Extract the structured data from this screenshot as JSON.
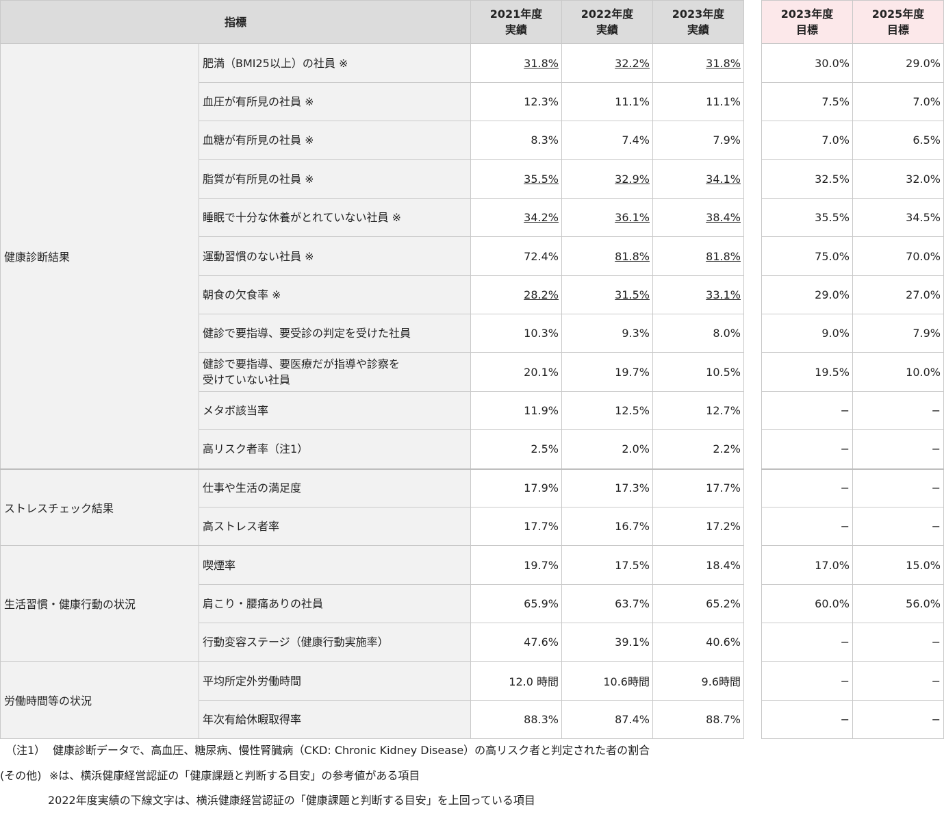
{
  "header": {
    "indicator": "指標",
    "cols": [
      {
        "l1": "2021年度",
        "l2": "実績"
      },
      {
        "l1": "2022年度",
        "l2": "実績"
      },
      {
        "l1": "2023年度",
        "l2": "実績"
      },
      {
        "l1": "2023年度",
        "l2": "目標"
      },
      {
        "l1": "2025年度",
        "l2": "目標"
      }
    ]
  },
  "groups": [
    {
      "name": "健康診断結果",
      "rows": [
        {
          "label": "肥満（BMI25以上）の社員 ※",
          "v": [
            "31.8%",
            "32.2%",
            "31.8%",
            "30.0%",
            "29.0%"
          ],
          "u": [
            true,
            true,
            true,
            false,
            false
          ]
        },
        {
          "label": "血圧が有所見の社員 ※",
          "v": [
            "12.3%",
            "11.1%",
            "11.1%",
            "7.5%",
            "7.0%"
          ],
          "u": [
            false,
            false,
            false,
            false,
            false
          ]
        },
        {
          "label": "血糖が有所見の社員 ※",
          "v": [
            "8.3%",
            "7.4%",
            "7.9%",
            "7.0%",
            "6.5%"
          ],
          "u": [
            false,
            false,
            false,
            false,
            false
          ]
        },
        {
          "label": "脂質が有所見の社員 ※",
          "v": [
            "35.5%",
            "32.9%",
            "34.1%",
            "32.5%",
            "32.0%"
          ],
          "u": [
            true,
            true,
            true,
            false,
            false
          ]
        },
        {
          "label": "睡眠で十分な休養がとれていない社員 ※",
          "v": [
            "34.2%",
            "36.1%",
            "38.4%",
            "35.5%",
            "34.5%"
          ],
          "u": [
            true,
            true,
            true,
            false,
            false
          ]
        },
        {
          "label": "運動習慣のない社員 ※",
          "v": [
            "72.4%",
            "81.8%",
            "81.8%",
            "75.0%",
            "70.0%"
          ],
          "u": [
            false,
            true,
            true,
            false,
            false
          ]
        },
        {
          "label": "朝食の欠食率 ※",
          "v": [
            "28.2%",
            "31.5%",
            "33.1%",
            "29.0%",
            "27.0%"
          ],
          "u": [
            true,
            true,
            true,
            false,
            false
          ]
        },
        {
          "label": "健診で要指導、要受診の判定を受けた社員",
          "v": [
            "10.3%",
            "9.3%",
            "8.0%",
            "9.0%",
            "7.9%"
          ],
          "u": [
            false,
            false,
            false,
            false,
            false
          ]
        },
        {
          "label": "健診で要指導、要医療だが指導や診察を",
          "label2": "受けていない社員",
          "v": [
            "20.1%",
            "19.7%",
            "10.5%",
            "19.5%",
            "10.0%"
          ],
          "u": [
            false,
            false,
            false,
            false,
            false
          ]
        },
        {
          "label": "メタボ該当率",
          "v": [
            "11.9%",
            "12.5%",
            "12.7%",
            "−",
            "−"
          ],
          "u": [
            false,
            false,
            false,
            false,
            false
          ]
        },
        {
          "label": "高リスク者率（注1）",
          "v": [
            "2.5%",
            "2.0%",
            "2.2%",
            "−",
            "−"
          ],
          "u": [
            false,
            false,
            false,
            false,
            false
          ]
        }
      ]
    },
    {
      "name": "ストレスチェック結果",
      "rows": [
        {
          "label": "仕事や生活の満足度",
          "v": [
            "17.9%",
            "17.3%",
            "17.7%",
            "−",
            "−"
          ],
          "u": [
            false,
            false,
            false,
            false,
            false
          ]
        },
        {
          "label": "高ストレス者率",
          "v": [
            "17.7%",
            "16.7%",
            "17.2%",
            "−",
            "−"
          ],
          "u": [
            false,
            false,
            false,
            false,
            false
          ]
        }
      ]
    },
    {
      "name": "生活習慣・健康行動の状況",
      "rows": [
        {
          "label": "喫煙率",
          "v": [
            "19.7%",
            "17.5%",
            "18.4%",
            "17.0%",
            "15.0%"
          ],
          "u": [
            false,
            false,
            false,
            false,
            false
          ]
        },
        {
          "label": "肩こり・腰痛ありの社員",
          "v": [
            "65.9%",
            "63.7%",
            "65.2%",
            "60.0%",
            "56.0%"
          ],
          "u": [
            false,
            false,
            false,
            false,
            false
          ]
        },
        {
          "label": "行動変容ステージ（健康行動実施率）",
          "v": [
            "47.6%",
            "39.1%",
            "40.6%",
            "−",
            "−"
          ],
          "u": [
            false,
            false,
            false,
            false,
            false
          ]
        }
      ]
    },
    {
      "name": "労働時間等の状況",
      "rows": [
        {
          "label": "平均所定外労働時間",
          "v": [
            "12.0 時間",
            "10.6時間",
            "9.6時間",
            "−",
            "−"
          ],
          "u": [
            false,
            false,
            false,
            false,
            false
          ]
        },
        {
          "label": "年次有給休暇取得率",
          "v": [
            "88.3%",
            "87.4%",
            "88.7%",
            "−",
            "−"
          ],
          "u": [
            false,
            false,
            false,
            false,
            false
          ]
        }
      ]
    }
  ],
  "notes": {
    "n1_key": "（注1）",
    "n1_text": "健康診断データで、高血圧、糖尿病、慢性腎臓病（CKD: Chronic Kidney Disease）の高リスク者と判定された者の割合",
    "n2_key": "(その他)",
    "n2_text": "※は、横浜健康経営認証の「健康課題と判断する目安」の参考値がある項目",
    "n3_text": "2022年度実績の下線文字は、横浜健康経営認証の「健康課題と判断する目安」を上回っている項目"
  }
}
